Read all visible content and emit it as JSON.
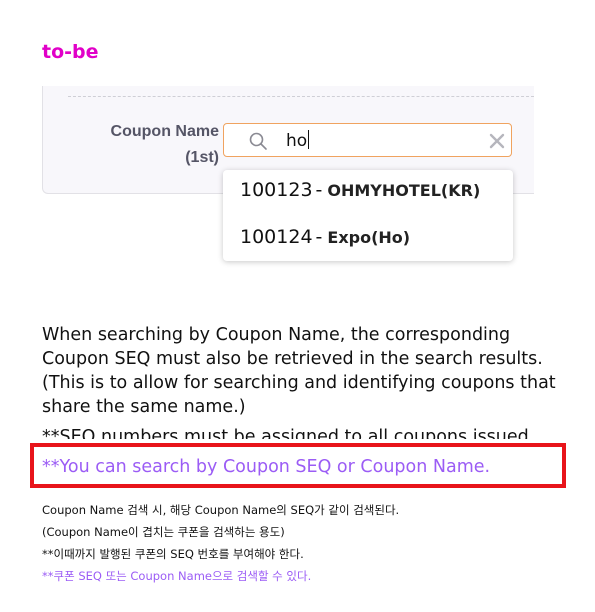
{
  "heading": "to-be",
  "form": {
    "label_line1": "Coupon Name",
    "label_line2": "(1st)",
    "search_value": "ho",
    "search_icon": "search-icon",
    "clear_icon": "close-icon"
  },
  "dropdown": {
    "items": [
      {
        "seq": "100123",
        "separator": "-",
        "name": "OHMYHOTEL(KR)"
      },
      {
        "seq": "100124",
        "separator": "-",
        "name": "Expo(Ho)"
      }
    ]
  },
  "description": {
    "paragraph": "When searching by Coupon Name, the corresponding Coupon SEQ must also be retrieved in the search results. (This is to allow for searching and identifying coupons that share the same name.)",
    "note": "**SEQ numbers must be assigned to all coupons issued.",
    "highlight": "**You can search by Coupon SEQ or Coupon Name."
  },
  "korean_notes": {
    "line1": "Coupon Name 검색 시, 해당 Coupon Name의 SEQ가 같이 검색된다.",
    "line2": "(Coupon Name이 겹치는 쿠폰을 검색하는 용도)",
    "line3": "**이때까지 발행된 쿠폰의 SEQ 번호를 부여해야 한다.",
    "line4": "**쿠폰 SEQ 또는 Coupon Name으로 검색할 수 있다."
  },
  "colors": {
    "heading": "#e100c8",
    "highlight_border": "#e8141a",
    "highlight_text": "#9b5cf5",
    "input_focus_border": "#f0a35f"
  }
}
